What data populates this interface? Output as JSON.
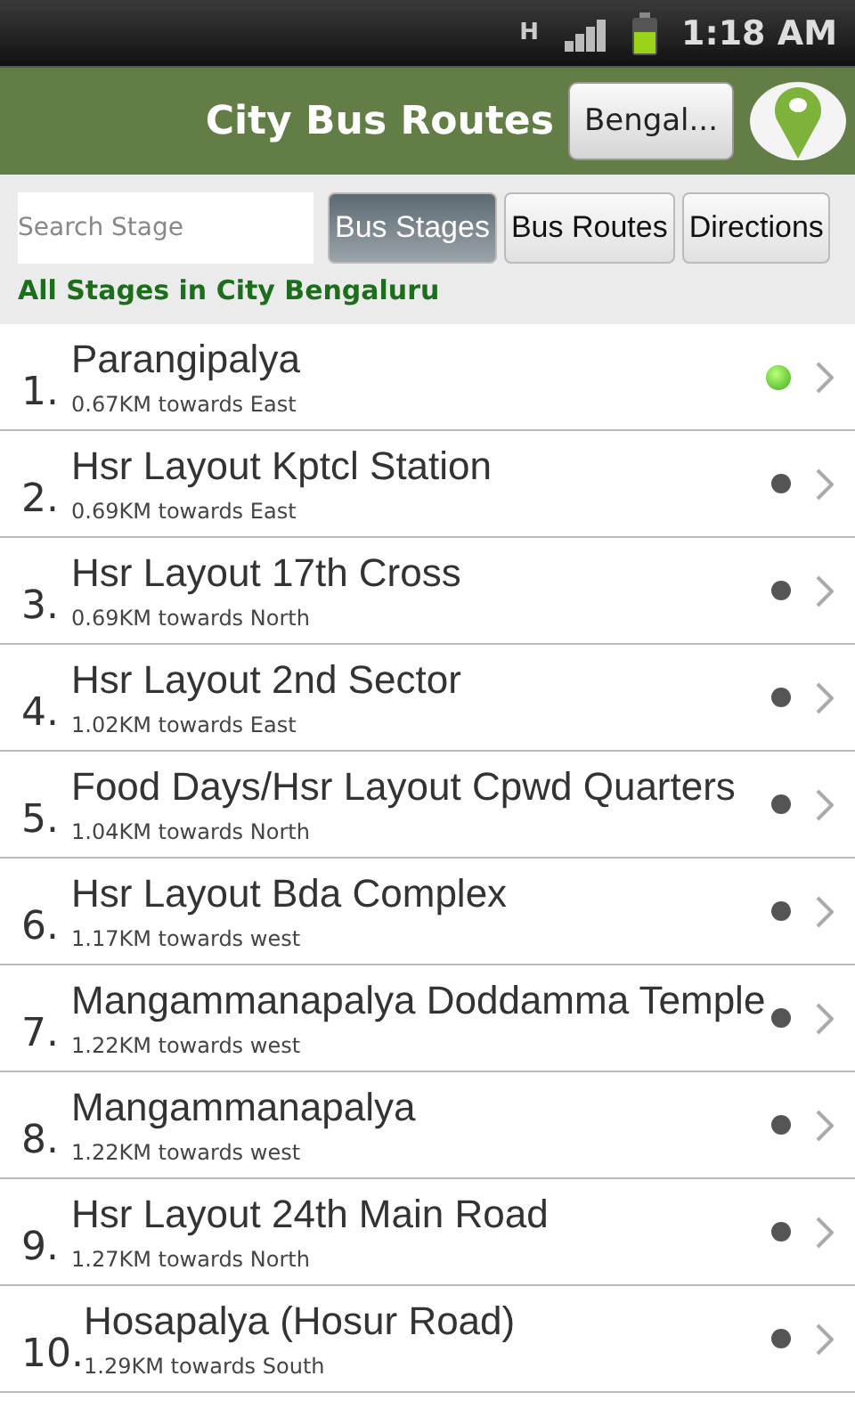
{
  "status_bar": {
    "network": "H",
    "time": "1:18 AM"
  },
  "header": {
    "title": "City Bus Routes",
    "city_button": "Bengal..."
  },
  "search": {
    "placeholder": "Search Stage"
  },
  "tabs": [
    {
      "label": "Bus Stages",
      "selected": true
    },
    {
      "label": "Bus Routes",
      "selected": false
    },
    {
      "label": "Directions",
      "selected": false
    }
  ],
  "subtitle": "All Stages in City Bengaluru",
  "stages": [
    {
      "number": "1.",
      "name": "Parangipalya",
      "distance": "0.67KM towards East",
      "active": true
    },
    {
      "number": "2.",
      "name": "Hsr Layout Kptcl Station",
      "distance": "0.69KM towards East",
      "active": false
    },
    {
      "number": "3.",
      "name": "Hsr Layout 17th Cross",
      "distance": "0.69KM towards North",
      "active": false
    },
    {
      "number": "4.",
      "name": "Hsr Layout 2nd Sector",
      "distance": "1.02KM towards East",
      "active": false
    },
    {
      "number": "5.",
      "name": "Food Days/Hsr Layout Cpwd Quarters",
      "distance": "1.04KM towards North",
      "active": false
    },
    {
      "number": "6.",
      "name": "Hsr Layout Bda Complex",
      "distance": "1.17KM towards west",
      "active": false
    },
    {
      "number": "7.",
      "name": "Mangammanapalya Doddamma Temple",
      "distance": "1.22KM towards west",
      "active": false
    },
    {
      "number": "8.",
      "name": "Mangammanapalya",
      "distance": "1.22KM towards west",
      "active": false
    },
    {
      "number": "9.",
      "name": "Hsr Layout 24th Main Road",
      "distance": "1.27KM towards North",
      "active": false
    },
    {
      "number": "10.",
      "name": "Hosapalya (Hosur Road)",
      "distance": "1.29KM towards South",
      "active": false
    }
  ]
}
